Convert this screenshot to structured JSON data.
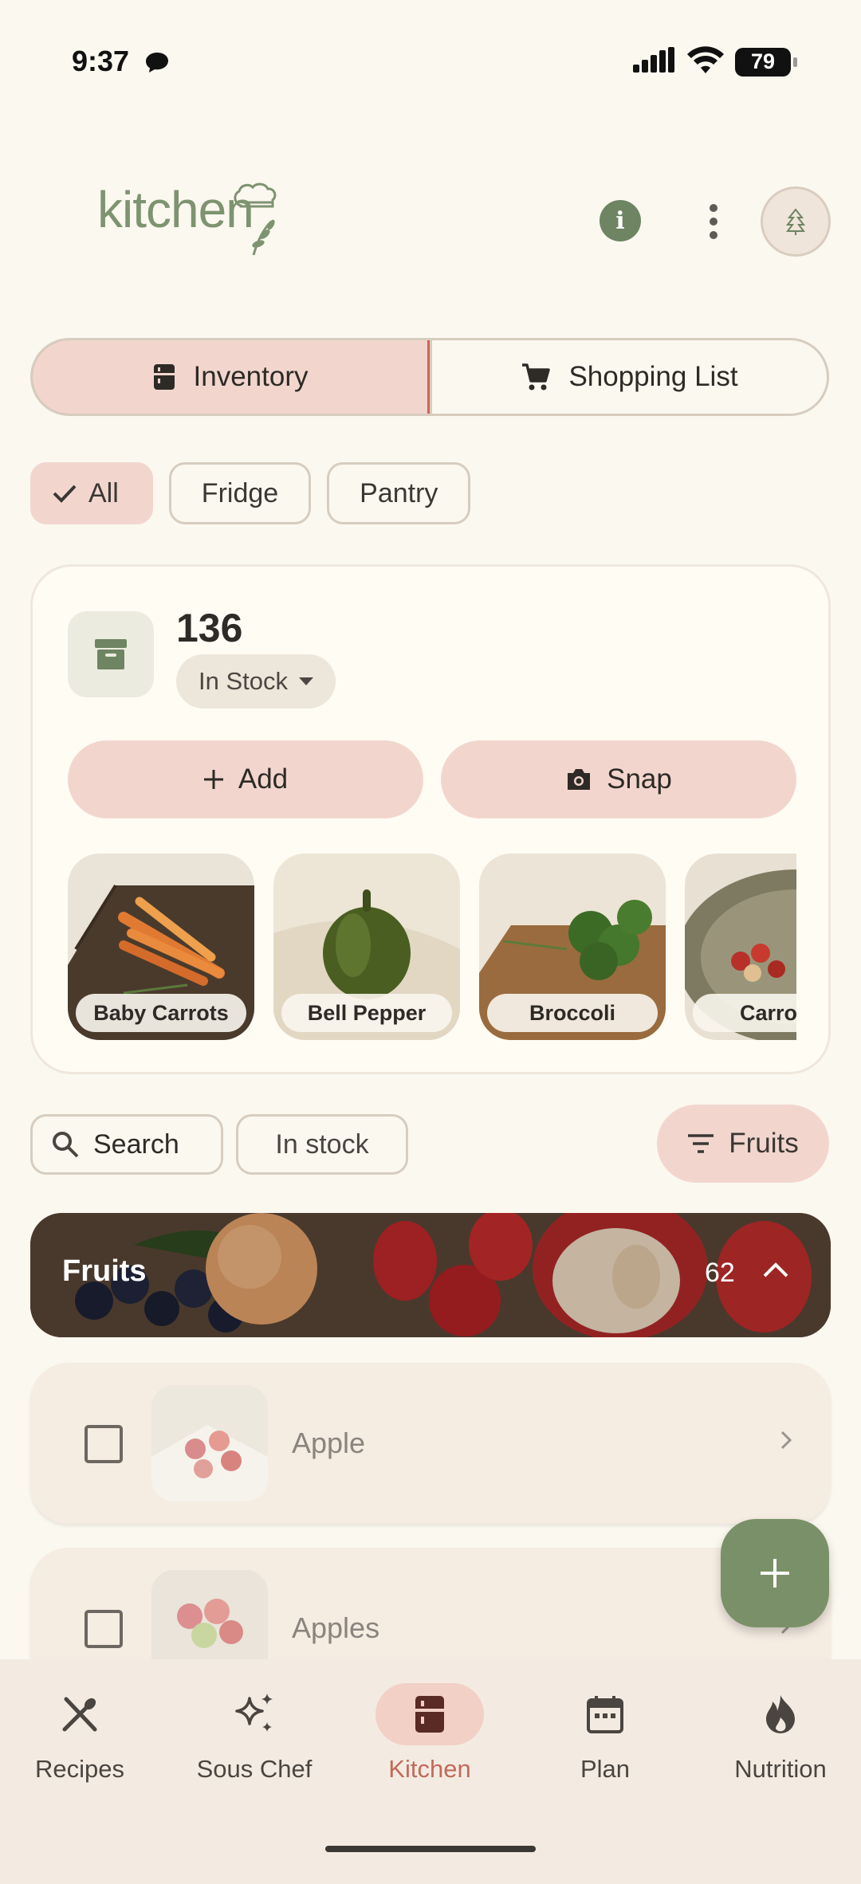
{
  "status_bar": {
    "time": "9:37",
    "battery": "79"
  },
  "header": {
    "logo_text": "kitchen"
  },
  "view_toggle": {
    "inventory": "Inventory",
    "shopping_list": "Shopping List",
    "selected": "Inventory"
  },
  "location_filters": [
    {
      "label": "All",
      "selected": true
    },
    {
      "label": "Fridge",
      "selected": false
    },
    {
      "label": "Pantry",
      "selected": false
    }
  ],
  "summary": {
    "count": "136",
    "status": "In Stock",
    "add_label": "Add",
    "snap_label": "Snap",
    "recent_items": [
      "Baby Carrots",
      "Bell Pepper",
      "Broccoli",
      "Carrots"
    ]
  },
  "toolbar": {
    "search_label": "Search",
    "in_stock_label": "In stock",
    "category_filter": "Fruits"
  },
  "category": {
    "title": "Fruits",
    "count": "62"
  },
  "items": [
    {
      "name": "Apple"
    },
    {
      "name": "Apples"
    }
  ],
  "nav": {
    "items": [
      {
        "label": "Recipes",
        "active": false
      },
      {
        "label": "Sous Chef",
        "active": false
      },
      {
        "label": "Kitchen",
        "active": true
      },
      {
        "label": "Plan",
        "active": false
      },
      {
        "label": "Nutrition",
        "active": false
      }
    ]
  },
  "colors": {
    "accent": "#F2D6CE",
    "brand_green": "#7A9068",
    "active_text": "#C26A5A",
    "background": "#FBF8F0"
  }
}
